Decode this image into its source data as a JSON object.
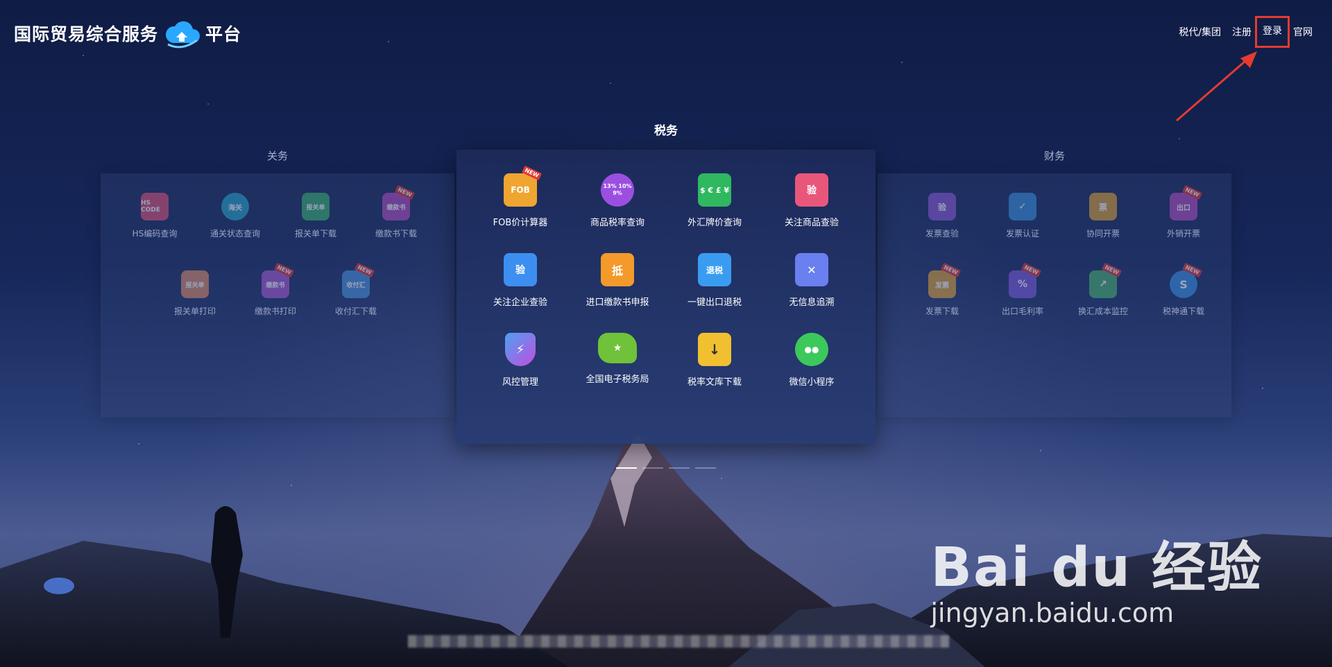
{
  "header": {
    "logo_text_left": "国际贸易综合服务",
    "logo_text_right": "平台",
    "nav": [
      "税代/集团",
      "注册",
      "登录",
      "官网"
    ]
  },
  "panels": {
    "customs": {
      "title": "关务",
      "items": [
        {
          "label": "HS编码查询",
          "icon_text": "HS CODE",
          "color": "#d9547a"
        },
        {
          "label": "通关状态查询",
          "icon_text": "海关",
          "color": "#2aa4c9"
        },
        {
          "label": "报关单下载",
          "icon_text": "报关单",
          "color": "#3bb070"
        },
        {
          "label": "缴款书下载",
          "icon_text": "缴款书",
          "color": "#b04fbf",
          "new": "NEW"
        },
        {
          "label": "报关单打印",
          "icon_text": "报关单",
          "color": "#d98b6a"
        },
        {
          "label": "缴款书打印",
          "icon_text": "缴款书",
          "color": "#a65ad1",
          "new": "NEW"
        },
        {
          "label": "收付汇下载",
          "icon_text": "收付汇",
          "color": "#4a8fd9",
          "new": "NEW"
        }
      ]
    },
    "tax": {
      "title": "税务",
      "items": [
        {
          "label": "FOB价计算器",
          "icon_text": "FOB",
          "color": "#f0a530",
          "new": "NEW"
        },
        {
          "label": "商品税率查询",
          "icon_text": "13% 10% 9%",
          "color": "#9b4fe0"
        },
        {
          "label": "外汇牌价查询",
          "icon_text": "$ € £ ¥",
          "color": "#2fb860"
        },
        {
          "label": "关注商品查验",
          "icon_text": "验",
          "color": "#e8577a"
        },
        {
          "label": "关注企业查验",
          "icon_text": "验",
          "color": "#3c8ff0"
        },
        {
          "label": "进口缴款书申报",
          "icon_text": "抵",
          "color": "#f39a2a"
        },
        {
          "label": "一键出口退税",
          "icon_text": "退税",
          "color": "#3a9cf0"
        },
        {
          "label": "无信息追溯",
          "icon_text": "✕",
          "color": "#6a7ff0"
        },
        {
          "label": "风控管理",
          "icon_text": "⚡",
          "color": "#8a5cf0"
        },
        {
          "label": "全国电子税务局",
          "icon_text": "★",
          "color": "#6fc23a"
        },
        {
          "label": "税率文库下载",
          "icon_text": "↓",
          "color": "#f0c030"
        },
        {
          "label": "微信小程序",
          "icon_text": "●●",
          "color": "#3cc85a"
        }
      ]
    },
    "finance": {
      "title": "财务",
      "items": [
        {
          "label": "发票查验",
          "icon_text": "验",
          "color": "#8a5ad1"
        },
        {
          "label": "发票认证",
          "icon_text": "✓",
          "color": "#3a8fd9"
        },
        {
          "label": "协同开票",
          "icon_text": "票",
          "color": "#d9a03a"
        },
        {
          "label": "外销开票",
          "icon_text": "出口",
          "color": "#b04fbf",
          "new": "NEW"
        },
        {
          "label": "发票下载",
          "icon_text": "发票",
          "color": "#d9a03a",
          "new": "NEW"
        },
        {
          "label": "出口毛利率",
          "icon_text": "%",
          "color": "#7a5ad9",
          "new": "NEW"
        },
        {
          "label": "换汇成本监控",
          "icon_text": "↗",
          "color": "#4ab070",
          "new": "NEW"
        },
        {
          "label": "税神通下载",
          "icon_text": "S",
          "color": "#3a8fe0",
          "new": "NEW"
        }
      ]
    }
  },
  "watermark": {
    "main": "Bai du 经验",
    "sub": "jingyan.baidu.com"
  },
  "colors": {
    "highlight": "#e53b2f"
  }
}
